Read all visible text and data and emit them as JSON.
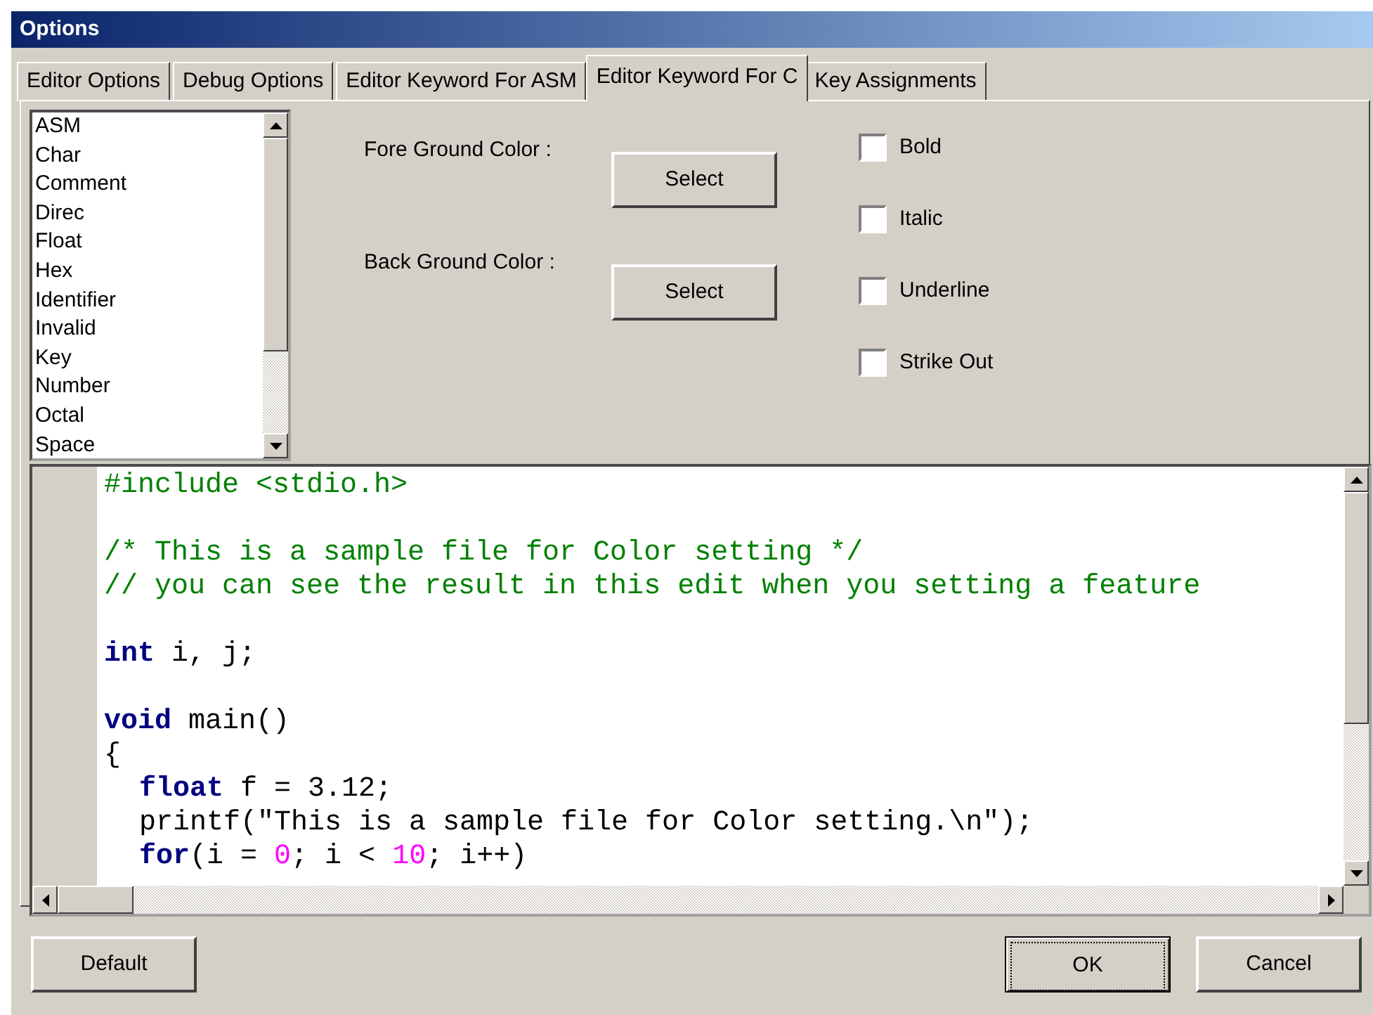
{
  "window": {
    "title": "Options"
  },
  "tabs": [
    {
      "label": "Editor Options",
      "selected": false
    },
    {
      "label": "Debug Options",
      "selected": false
    },
    {
      "label": "Editor Keyword For ASM",
      "selected": false
    },
    {
      "label": "Editor Keyword For C",
      "selected": true
    },
    {
      "label": "Key Assignments",
      "selected": false
    }
  ],
  "keyword_list": [
    {
      "label": "ASM",
      "selected": false
    },
    {
      "label": "Char",
      "selected": false
    },
    {
      "label": "Comment",
      "selected": false
    },
    {
      "label": "Direc",
      "selected": false
    },
    {
      "label": "Float",
      "selected": false
    },
    {
      "label": "Hex",
      "selected": false
    },
    {
      "label": "Identifier",
      "selected": false
    },
    {
      "label": "Invalid",
      "selected": false
    },
    {
      "label": "Key",
      "selected": false
    },
    {
      "label": "Number",
      "selected": false
    },
    {
      "label": "Octal",
      "selected": false
    },
    {
      "label": "Space",
      "selected": false
    }
  ],
  "color_settings": [
    {
      "label": "Fore Ground Color :",
      "button": "Select"
    },
    {
      "label": "Back Ground Color :",
      "button": "Select"
    }
  ],
  "style_options": [
    {
      "label": "Bold",
      "checked": false
    },
    {
      "label": "Italic",
      "checked": false
    },
    {
      "label": "Underline",
      "checked": false
    },
    {
      "label": "Strike Out",
      "checked": false
    }
  ],
  "code_preview": [
    {
      "blank_line_before": false,
      "indented": false,
      "tokens": [
        {
          "kind": "directive",
          "text": "#include <stdio.h>"
        }
      ]
    },
    {
      "blank_line_before": true,
      "indented": false,
      "tokens": [
        {
          "kind": "comment",
          "text": "/* This is a sample file for Color setting */"
        }
      ]
    },
    {
      "blank_line_before": false,
      "indented": false,
      "tokens": [
        {
          "kind": "comment",
          "text": "// you can see the result in this edit when you setting a feature"
        }
      ]
    },
    {
      "blank_line_before": true,
      "indented": false,
      "tokens": [
        {
          "kind": "keyword",
          "text": "int"
        },
        {
          "kind": "plain",
          "text": " i, j;"
        }
      ]
    },
    {
      "blank_line_before": true,
      "indented": false,
      "tokens": [
        {
          "kind": "keyword",
          "text": "void"
        },
        {
          "kind": "plain",
          "text": " main()"
        }
      ]
    },
    {
      "blank_line_before": false,
      "indented": false,
      "tokens": [
        {
          "kind": "plain",
          "text": "{"
        }
      ]
    },
    {
      "blank_line_before": false,
      "indented": true,
      "tokens": [
        {
          "kind": "keyword",
          "text": "float"
        },
        {
          "kind": "plain",
          "text": " f = 3.12;"
        }
      ]
    },
    {
      "blank_line_before": false,
      "indented": true,
      "tokens": [
        {
          "kind": "plain",
          "text": "printf(\"This is a sample file for Color setting.\\n\");"
        }
      ]
    },
    {
      "blank_line_before": false,
      "indented": true,
      "tokens": [
        {
          "kind": "keyword",
          "text": "for"
        },
        {
          "kind": "plain",
          "text": "(i = "
        },
        {
          "kind": "number",
          "text": "0"
        },
        {
          "kind": "plain",
          "text": "; i < "
        },
        {
          "kind": "number",
          "text": "10"
        },
        {
          "kind": "plain",
          "text": "; i++)"
        }
      ]
    }
  ],
  "buttons": [
    {
      "label": "Default",
      "focused": false
    },
    {
      "label": "OK",
      "focused": true
    },
    {
      "label": "Cancel",
      "focused": false
    }
  ]
}
